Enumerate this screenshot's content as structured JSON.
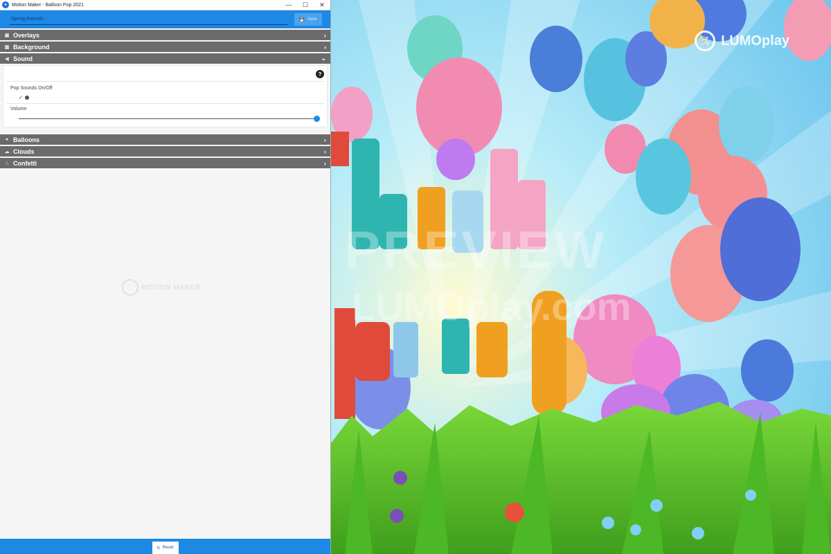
{
  "window": {
    "title": "Motion Maker - Balloon Pop 2021",
    "controls": {
      "minimize": "—",
      "maximize": "☐",
      "close": "✕"
    }
  },
  "toolbar": {
    "name_value": "Spring Animals",
    "save_label": "Save"
  },
  "sections": {
    "overlays": "Overlays",
    "background": "Background",
    "sound": "Sound",
    "balloons": "Balloons",
    "clouds": "Clouds",
    "confetti": "Confetti"
  },
  "sound_panel": {
    "help": "?",
    "pop_label": "Pop Sounds On/Off",
    "pop_check": "✓",
    "volume_label": "Volume",
    "volume_level": 1.0
  },
  "watermark_left": "MOTION MAKER",
  "bottombar": {
    "reset_label": "Reset"
  },
  "preview": {
    "brand": "LUMOplay",
    "watermark": "PREVIEW",
    "site_watermark": "LUMOplay.com",
    "headline_word_1": "hink",
    "headline_word_2": "pring"
  },
  "colors": {
    "accent": "#1e88e5",
    "section_header": "#6b6b6b",
    "sky": "#87d3f0",
    "grass": "#5cc42a"
  }
}
